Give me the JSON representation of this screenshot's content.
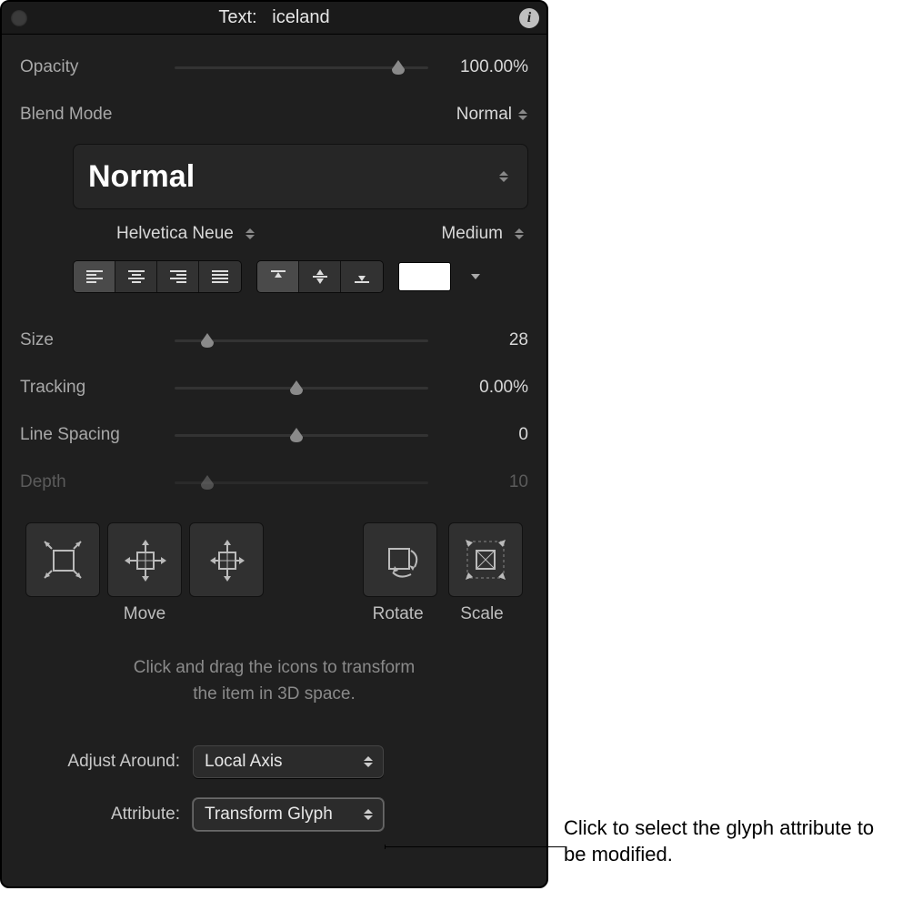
{
  "title": {
    "label": "Text:",
    "name": "iceland",
    "info_icon": "info-icon"
  },
  "opacity": {
    "label": "Opacity",
    "value": "100.00%",
    "slider_pos": 0.88
  },
  "blend": {
    "label": "Blend Mode",
    "value": "Normal"
  },
  "style": {
    "big": "Normal"
  },
  "font": {
    "family": "Helvetica Neue",
    "weight": "Medium"
  },
  "size": {
    "label": "Size",
    "value": "28",
    "slider_pos": 0.13
  },
  "tracking": {
    "label": "Tracking",
    "value": "0.00%",
    "slider_pos": 0.48
  },
  "linespacing": {
    "label": "Line Spacing",
    "value": "0",
    "slider_pos": 0.48
  },
  "depth": {
    "label": "Depth",
    "value": "10",
    "slider_pos": 0.13
  },
  "transform_labels": {
    "move": "Move",
    "rotate": "Rotate",
    "scale": "Scale"
  },
  "hint_line1": "Click and drag the icons to transform",
  "hint_line2": "the item in 3D space.",
  "adjust": {
    "label": "Adjust Around:",
    "value": "Local Axis"
  },
  "attribute": {
    "label": "Attribute:",
    "value": "Transform Glyph"
  },
  "callout": "Click to select the glyph attribute to be modified."
}
